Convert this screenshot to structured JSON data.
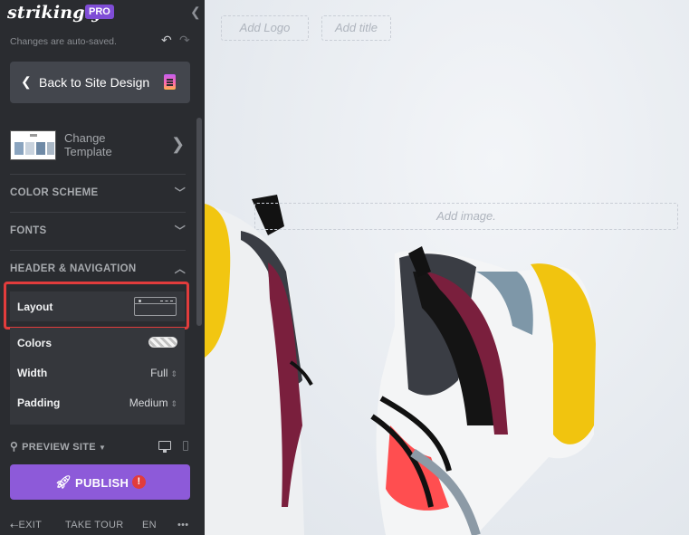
{
  "app": {
    "brand": "strikingly",
    "plan_badge": "PRO"
  },
  "status": {
    "autosave": "Changes are auto-saved."
  },
  "nav": {
    "back_label": "Back to Site Design"
  },
  "template": {
    "label": "Change Template"
  },
  "sections": [
    {
      "id": "color_scheme",
      "label": "COLOR SCHEME",
      "expanded": false
    },
    {
      "id": "fonts",
      "label": "FONTS",
      "expanded": false
    },
    {
      "id": "header_nav",
      "label": "HEADER & NAVIGATION",
      "expanded": true
    }
  ],
  "header_settings": {
    "layout": {
      "label": "Layout",
      "value_icon": "header-layout-icon",
      "highlighted": true
    },
    "colors": {
      "label": "Colors",
      "value_icon": "checker-toggle-icon"
    },
    "width": {
      "label": "Width",
      "value": "Full"
    },
    "padding": {
      "label": "Padding",
      "value": "Medium"
    }
  },
  "preview": {
    "label": "PREVIEW SITE"
  },
  "publish": {
    "label": "PUBLISH"
  },
  "footer": {
    "exit": "EXIT",
    "tour": "TAKE TOUR",
    "lang": "EN",
    "more": "•••"
  },
  "canvas": {
    "add_logo": "Add Logo",
    "add_title": "Add title",
    "add_image": "Add image."
  },
  "colors": {
    "sidebar_bg": "#2a2c30",
    "accent_purple": "#8d5ad9",
    "highlight_red": "#e23c3c",
    "shoe_yellow": "#f1c40f",
    "shoe_maroon": "#7a1f3d"
  }
}
